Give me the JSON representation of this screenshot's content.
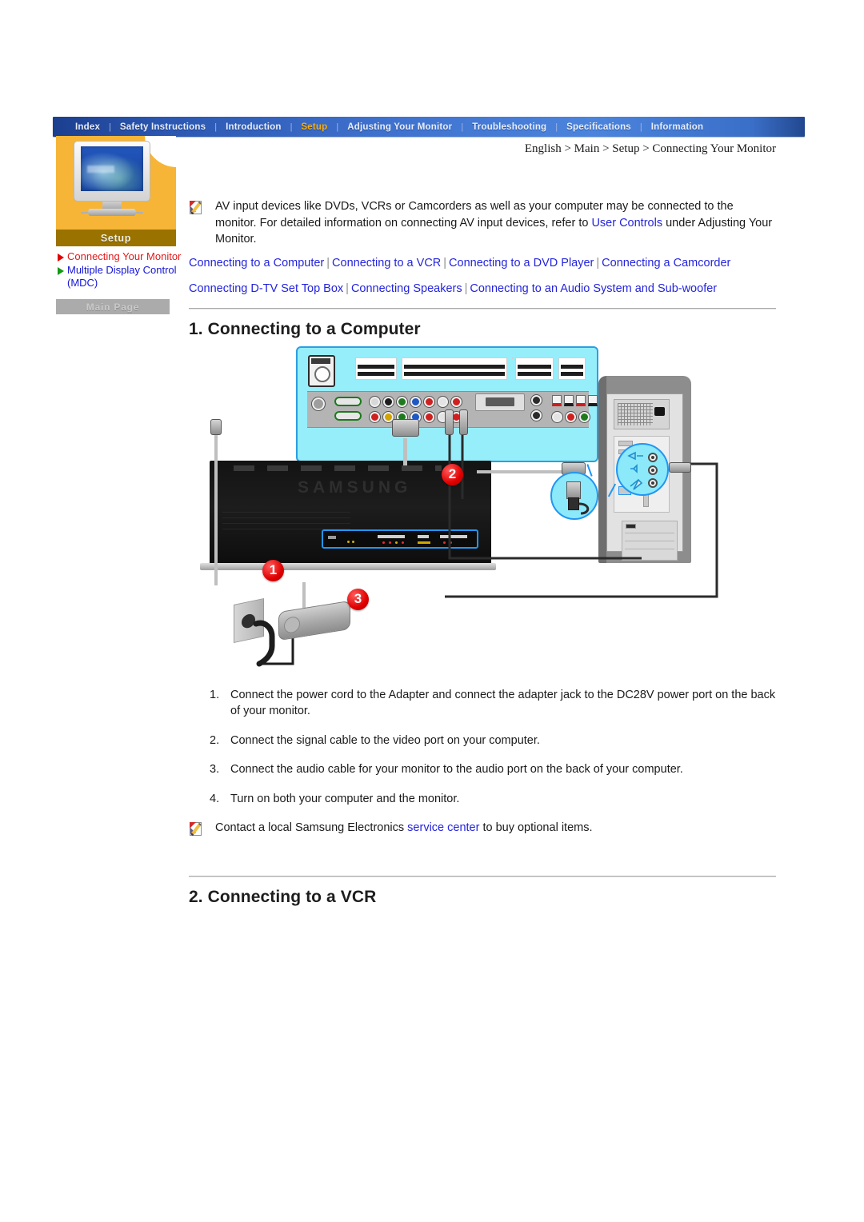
{
  "topnav": {
    "items": [
      {
        "label": "Index",
        "active": false
      },
      {
        "label": "Safety Instructions",
        "active": false
      },
      {
        "label": "Introduction",
        "active": false
      },
      {
        "label": "Setup",
        "active": true
      },
      {
        "label": "Adjusting Your Monitor",
        "active": false
      },
      {
        "label": "Troubleshooting",
        "active": false
      },
      {
        "label": "Specifications",
        "active": false
      },
      {
        "label": "Information",
        "active": false
      }
    ],
    "separator": "|",
    "active_color": "#ffae00",
    "text_color": "#e9eef9"
  },
  "sidebar": {
    "panel_color": "#f6b537",
    "section_label": "Setup",
    "links": [
      {
        "label": "Connecting Your Monitor",
        "color": "red",
        "marker": "red-triangle"
      },
      {
        "label": "Multiple Display Control (MDC)",
        "color": "blue",
        "marker": "green-triangle"
      }
    ],
    "main_page_button": "Main Page"
  },
  "content": {
    "breadcrumb": "English > Main > Setup > Connecting Your Monitor",
    "note": {
      "text_before": "AV input devices like DVDs, VCRs or Camcorders as well as your computer may be connected to the monitor. For detailed information on connecting AV input devices, refer to ",
      "link": "User Controls",
      "text_after": " under Adjusting Your Monitor."
    },
    "link_rows": [
      [
        "Connecting to a Computer",
        "Connecting to a VCR",
        "Connecting to a DVD Player",
        "Connecting a Camcorder"
      ],
      [
        "Connecting D-TV Set Top Box",
        "Connecting Speakers",
        "Connecting to an Audio System and Sub-woofer"
      ]
    ],
    "section1_title": "1. Connecting to a Computer",
    "section2_title": "2. Connecting to a VCR",
    "diagram": {
      "callouts": [
        "1",
        "2",
        "3"
      ],
      "monitor_logo": "SAMSUNG",
      "panel_background": "#96eefb",
      "highlight_color": "#2196f3"
    },
    "steps": [
      {
        "num": "1.",
        "text": "Connect the power cord to the Adapter and connect the adapter jack to the DC28V power port on the back of your monitor."
      },
      {
        "num": "2.",
        "text": "Connect the signal cable to the video port on your computer."
      },
      {
        "num": "3.",
        "text": "Connect the audio cable for your monitor to the audio port on the back of your computer."
      },
      {
        "num": "4.",
        "text": "Turn on both your computer and the monitor."
      }
    ],
    "note2": {
      "text_before": "Contact a local Samsung Electronics ",
      "link": "service center",
      "text_after": " to buy optional items."
    }
  }
}
